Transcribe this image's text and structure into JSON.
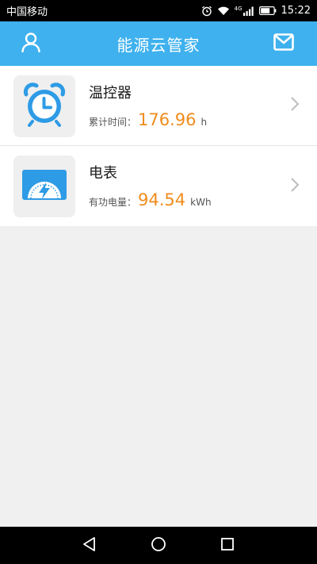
{
  "status_bar": {
    "carrier": "中国移动",
    "signal_label": "4G",
    "time": "15:22"
  },
  "header": {
    "title": "能源云管家",
    "icons": [
      "user-icon",
      "mail-icon"
    ]
  },
  "devices": [
    {
      "name": "温控器",
      "stat_label": "累计时间：",
      "stat_value": "176.96",
      "stat_unit": "h",
      "icon": "alarm-clock-icon"
    },
    {
      "name": "电表",
      "stat_label": "有功电量：",
      "stat_value": "94.54",
      "stat_unit": "kWh",
      "icon": "meter-gauge-icon"
    }
  ],
  "colors": {
    "header_bg": "#3fb1ee",
    "value_orange": "#f08c1c",
    "icon_blue": "#2e9be6",
    "page_bg": "#f0f0f0"
  },
  "nav_bar": {
    "icons": [
      "back-icon",
      "home-icon",
      "recents-icon"
    ]
  }
}
